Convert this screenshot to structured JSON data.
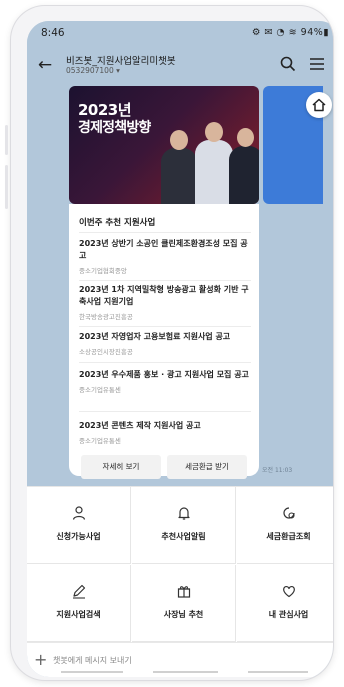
{
  "status": {
    "time": "8:46",
    "icons": "⚙ ✉ ◔ ≋ 94%▮"
  },
  "header": {
    "title": "비즈봇_지원사업알리미챗봇",
    "subtitle": "0532907100 ▾"
  },
  "banner": {
    "year": "2023년",
    "title": "경제정책방향"
  },
  "card": {
    "heading": "이번주 추천 지원사업",
    "items": [
      {
        "title": "2023년 상반기 소공인 클린제조환경조성 모집 공고",
        "org": "중소기업협회중앙"
      },
      {
        "title": "2023년 1차 지역밀착형 방송광고 활성화 기반 구축사업 지원기업",
        "org": "한국방송광고진흥공"
      },
      {
        "title": "2023년 자영업자 고용보험료 지원사업 공고",
        "org": "소상공인시장진흥공"
      },
      {
        "title": "2023년 우수제품 홍보 · 광고 지원사업 모집 공고",
        "org": "중소기업유통센"
      },
      {
        "title": "2023년 콘텐츠 제작 지원사업 공고",
        "org": "중소기업유통센"
      }
    ],
    "buttons": {
      "more": "자세히 보기",
      "tax_refund": "세금환급 받기"
    },
    "timestamp": "오전 11:03"
  },
  "menu": [
    {
      "label": "신청가능사업",
      "icon": "person-icon"
    },
    {
      "label": "추천사업알림",
      "icon": "bell-icon"
    },
    {
      "label": "세금환급조회",
      "icon": "refund-icon"
    },
    {
      "label": "지원사업검색",
      "icon": "pencil-icon"
    },
    {
      "label": "사장님 추천",
      "icon": "gift-icon"
    },
    {
      "label": "내 관심사업",
      "icon": "heart-icon"
    }
  ],
  "input": {
    "placeholder": "챗봇에게 메시지 보내기"
  }
}
